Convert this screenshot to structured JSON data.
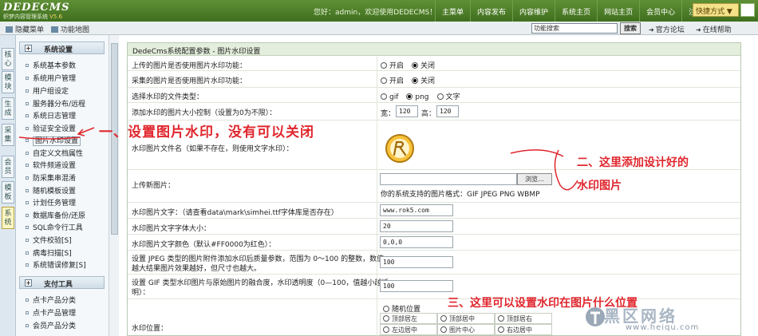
{
  "header": {
    "brand": "DEDECMS",
    "subtitle": "织梦内容管理系统",
    "version": "V5.6",
    "welcome": "您好：admin，欢迎使用DEDECMS！",
    "nav": [
      "主菜单",
      "内容发布",
      "内容维护",
      "系统主页",
      "网站主页",
      "会员中心",
      "注销"
    ],
    "quick_menu": "快捷方式"
  },
  "subbar": {
    "hide_menu": "隐藏菜单",
    "function_map": "功能地图",
    "search_value": "功能搜索",
    "search_button": "搜索",
    "forum_link": "官方论坛",
    "help_link": "在线帮助"
  },
  "vtabs": [
    "核心",
    "模块",
    "生成",
    "采集",
    "会员",
    "模板",
    "系统"
  ],
  "sidebar": {
    "section1_title": "系统设置",
    "items": [
      "系统基本参数",
      "系统用户管理",
      "用户组设定",
      "服务器分布/远程",
      "系统日志管理",
      "验证安全设置",
      "图片水印设置",
      "自定义文档属性",
      "软件频道设置",
      "防采集串混淆",
      "随机模板设置",
      "计划任务管理",
      "数据库备份/还原",
      "SQL命令行工具",
      "文件校验[S]",
      "病毒扫描[S]",
      "系统错误修复[S]"
    ],
    "section2_title": "支付工具",
    "items2": [
      "点卡产品分类",
      "点卡产品管理",
      "会员产品分类"
    ]
  },
  "panel": {
    "title": "DedeCms系统配置参数 - 图片水印设置",
    "rows": {
      "upload_wm": {
        "label": "上传的图片是否使用图片水印功能：",
        "opt_on": "开启",
        "opt_off": "关闭"
      },
      "collect_wm": {
        "label": "采集的图片是否使用图片水印功能：",
        "opt_on": "开启",
        "opt_off": "关闭"
      },
      "file_type": {
        "label": "选择水印的文件类型：",
        "opt1": "gif",
        "opt2": "png",
        "opt3": "文字"
      },
      "size_limit": {
        "label": "添加水印的图片大小控制（设置为0为不限）：",
        "width_label": "宽：",
        "width": "120",
        "height_label": "高：",
        "height": "120"
      },
      "wm_file": {
        "label": "水印图片文件名（如果不存在，则使用文字水印）："
      },
      "upload_new": {
        "label": "上传新图片：",
        "browse": "浏览...",
        "formats": "你的系统支持的图片格式：GIF JPEG PNG WBMP"
      },
      "wm_text": {
        "label": "水印图片文字：（请查看data\\mark\\simhei.ttf字体库是否存在）",
        "value": "www.rok5.com"
      },
      "font_size": {
        "label": "水印图片文字字体大小：",
        "value": "20"
      },
      "font_color": {
        "label": "水印图片文字颜色（默认#FF0000为红色）：",
        "value": "0,0,0"
      },
      "jpeg_quality": {
        "label1": "设置 JPEG 类型的图片附件添加水印后质量参数，范围为 0～100 的整数，数值",
        "label2": "越大结果图片效果越好，但尺寸也越大。",
        "value": "100"
      },
      "gif_alpha": {
        "label1": "设置 GIF 类型水印图片与原始图片的融合度，水印透明度（0—100，值越小越透",
        "label2": "明）：",
        "value": "100"
      },
      "position": {
        "label": "水印位置：",
        "random": "随机位置",
        "cells": [
          "顶部居左",
          "顶部居中",
          "顶部居右",
          "左边居中",
          "图片中心",
          "右边居中"
        ]
      }
    }
  },
  "annotations": {
    "a1": "一、设置图片水印，没有可以关闭",
    "a2_line1": "二、这里添加设计好的",
    "a2_line2": "水印图片",
    "a3": "三、这里可以设置水印在图片什么位置"
  },
  "watermark": {
    "big": "黑区网络",
    "url": "www.heiqu.com"
  }
}
